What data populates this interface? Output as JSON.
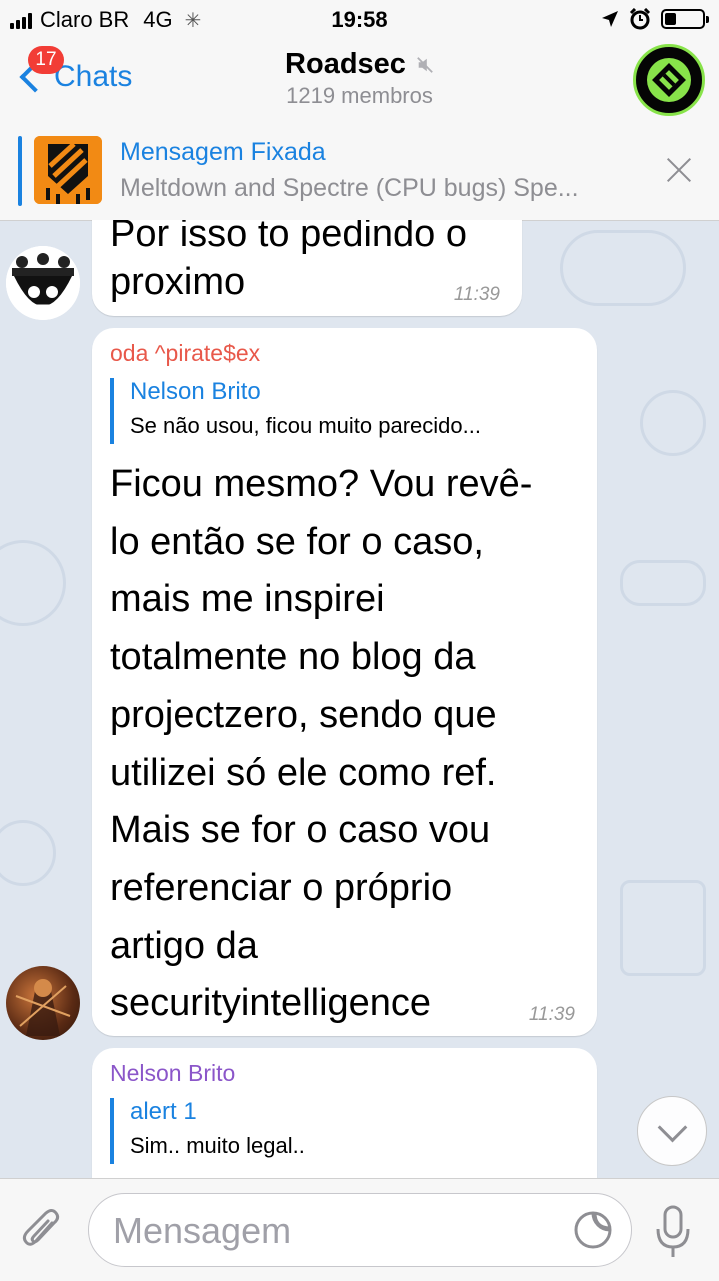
{
  "status_bar": {
    "carrier": "Claro BR",
    "network": "4G",
    "time": "19:58"
  },
  "nav": {
    "back_label": "Chats",
    "unread_badge": "17",
    "title": "Roadsec",
    "subtitle": "1219 membros"
  },
  "pinned": {
    "title": "Mensagem Fixada",
    "text": "Meltdown and Spectre (CPU bugs) Spe..."
  },
  "messages": [
    {
      "lines": [
        "Por isso to pedindo o",
        "proximo"
      ],
      "time": "11:39"
    },
    {
      "sender": "oda ^pirate$ex",
      "sender_color": "#e8584a",
      "reply_name": "Nelson Brito",
      "reply_text": "Se não usou, ficou muito parecido...",
      "lines": [
        "Ficou mesmo? Vou revê-",
        "lo então se for o caso,",
        "mais me inspirei",
        "totalmente no blog da",
        "projectzero, sendo que",
        "utilizei só ele como ref.",
        "Mais se for o caso vou",
        "referenciar o próprio",
        "artigo da",
        "securityintelligence"
      ],
      "time": "11:39"
    },
    {
      "sender": "Nelson Brito",
      "sender_color": "#8b56c9",
      "reply_name": "alert 1",
      "reply_text": "Sim.. muito legal.."
    }
  ],
  "input": {
    "placeholder": "Mensagem"
  },
  "colors": {
    "accent": "#1a82e0",
    "badge": "#f23d36",
    "chat_background": "#dfe6ef"
  }
}
